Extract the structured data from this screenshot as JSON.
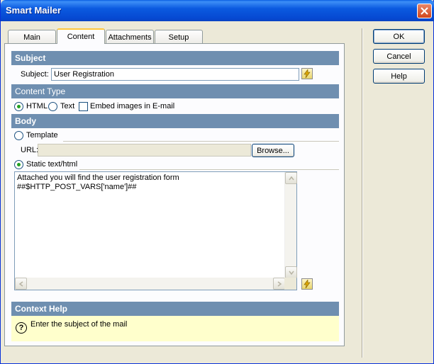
{
  "window": {
    "title": "Smart Mailer"
  },
  "tabs": [
    {
      "label": "Main",
      "active": false
    },
    {
      "label": "Content",
      "active": true
    },
    {
      "label": "Attachments",
      "active": false
    },
    {
      "label": "Setup",
      "active": false
    }
  ],
  "subject_section": {
    "header": "Subject",
    "label": "Subject:",
    "value": "User Registration"
  },
  "content_type": {
    "header": "Content Type",
    "html_label": "HTML",
    "text_label": "Text",
    "embed_label": "Embed images in E-mail",
    "selected": "HTML",
    "embed_checked": false
  },
  "body": {
    "header": "Body",
    "template_label": "Template",
    "url_label": "URL:",
    "url_value": "",
    "browse_label": "Browse...",
    "static_label": "Static text/html",
    "selected": "Static text/html",
    "content": "Attached you will find the user registration form\n##$HTTP_POST_VARS['name']##"
  },
  "context_help": {
    "header": "Context Help",
    "text": "Enter the subject of the mail"
  },
  "buttons": {
    "ok": "OK",
    "cancel": "Cancel",
    "help": "Help"
  },
  "colors": {
    "section_header": "#6f8fb0",
    "help_background": "#ffffcc",
    "titlebar": "#0b5ae0"
  }
}
